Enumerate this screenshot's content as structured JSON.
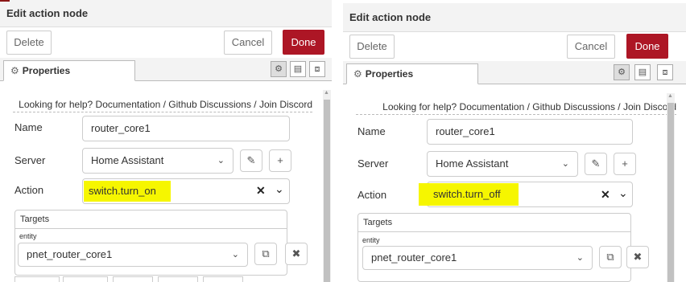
{
  "left": {
    "title": "Edit action node",
    "delete_label": "Delete",
    "cancel_label": "Cancel",
    "done_label": "Done",
    "tab_label": "Properties",
    "help_text": "Looking for help? Documentation / Github Discussions / Join Discord",
    "name_label": "Name",
    "name_value": "router_core1",
    "server_label": "Server",
    "server_value": "Home Assistant",
    "action_label": "Action",
    "action_value": "switch.turn_on",
    "targets_label": "Targets",
    "entity_label": "entity",
    "entity_value": "pnet_router_core1"
  },
  "right": {
    "title": "Edit action node",
    "delete_label": "Delete",
    "cancel_label": "Cancel",
    "done_label": "Done",
    "tab_label": "Properties",
    "help_text": "Looking for help? Documentation / Github Discussions / Join Discord",
    "name_label": "Name",
    "name_value": "router_core1",
    "server_label": "Server",
    "server_value": "Home Assistant",
    "action_label": "Action",
    "action_value": "switch.turn_off",
    "targets_label": "Targets",
    "entity_label": "entity",
    "entity_value": "pnet_router_core1"
  },
  "colors": {
    "done_button": "#ad1625",
    "highlight": "#f6f600"
  }
}
